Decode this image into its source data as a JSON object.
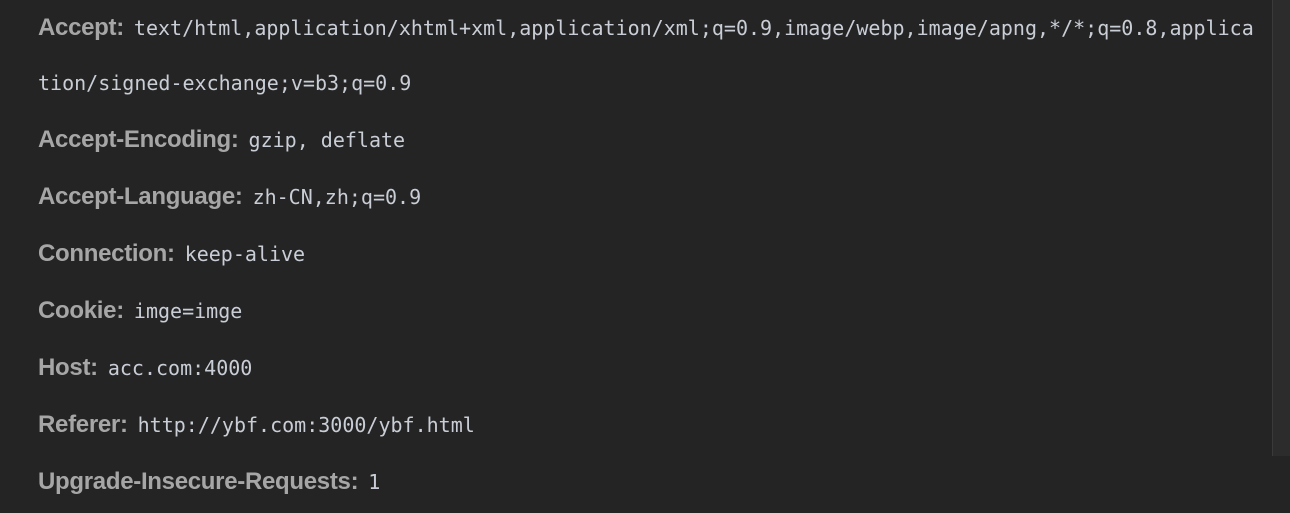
{
  "headers": [
    {
      "key": "Accept:",
      "value": "text/html,application/xhtml+xml,application/xml;q=0.9,image/webp,image/apng,*/*;q=0.8,application/signed-exchange;v=b3;q=0.9"
    },
    {
      "key": "Accept-Encoding:",
      "value": "gzip, deflate"
    },
    {
      "key": "Accept-Language:",
      "value": "zh-CN,zh;q=0.9"
    },
    {
      "key": "Connection:",
      "value": "keep-alive"
    },
    {
      "key": "Cookie:",
      "value": "imge=imge"
    },
    {
      "key": "Host:",
      "value": "acc.com:4000"
    },
    {
      "key": "Referer:",
      "value": "http://ybf.com:3000/ybf.html"
    },
    {
      "key": "Upgrade-Insecure-Requests:",
      "value": "1"
    }
  ]
}
